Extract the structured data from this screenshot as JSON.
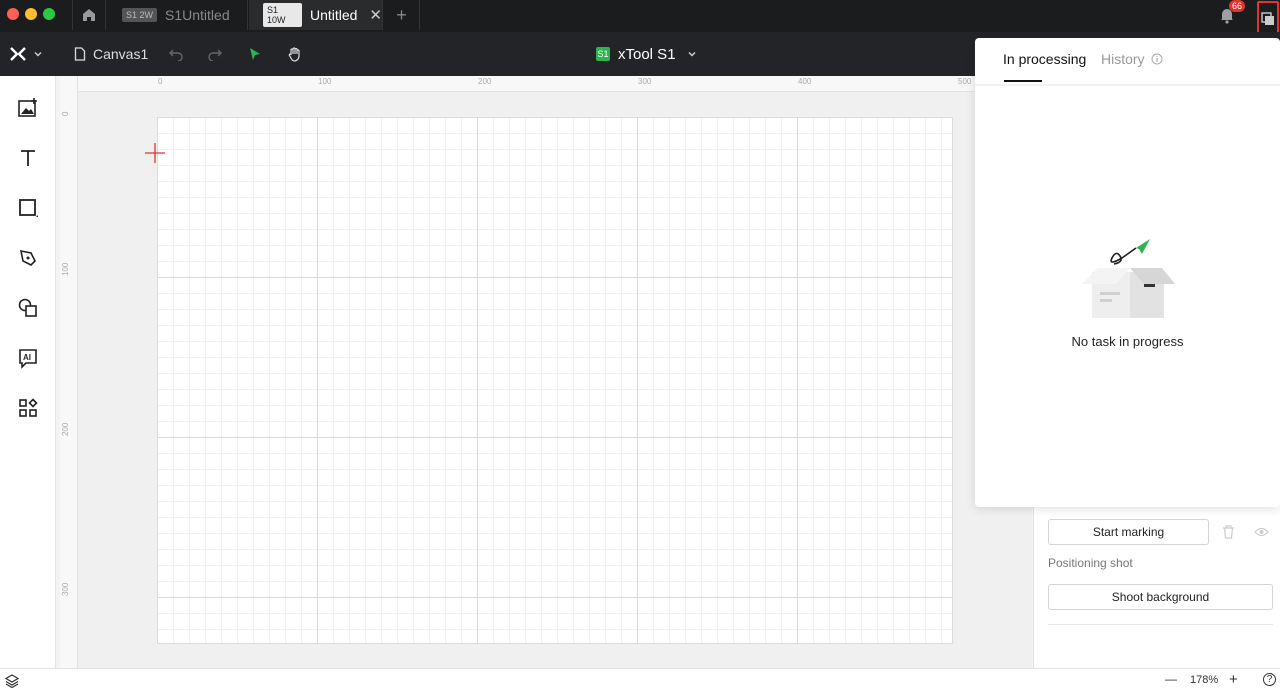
{
  "tabs": [
    {
      "badge": "S1 2W",
      "title": "S1Untitled"
    },
    {
      "badge": "S1 10W",
      "title": "Untitled",
      "close": "✕"
    }
  ],
  "tab_add": "+",
  "notifications": {
    "count": "66"
  },
  "toolbar": {
    "canvas_name": "Canvas1",
    "device_badge": "S1",
    "device_name": "xTool S1"
  },
  "rulers": {
    "top": [
      "0",
      "100",
      "200",
      "300",
      "400",
      "500"
    ],
    "left": [
      "0",
      "100",
      "200",
      "300"
    ]
  },
  "popover": {
    "tab_active": "In processing",
    "tab_inactive": "History",
    "empty_message": "No task in progress"
  },
  "right_panel": {
    "start_marking": "Start marking",
    "positioning_label": "Positioning shot",
    "shoot_background": "Shoot background"
  },
  "statusbar": {
    "zoom": "178%",
    "minus": "—",
    "plus": "+",
    "help": "?"
  },
  "colors": {
    "accent_green": "#2fb34e",
    "alert_red": "#e0342e"
  }
}
